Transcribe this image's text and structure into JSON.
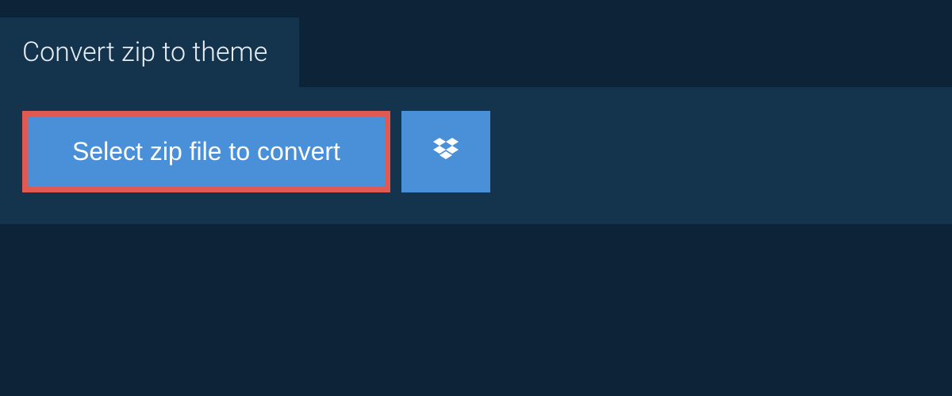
{
  "header": {
    "title": "Convert zip to theme"
  },
  "actions": {
    "select_label": "Select zip file to convert",
    "cloud_provider": "dropbox"
  },
  "colors": {
    "page_bg": "#0d2438",
    "panel_bg": "#14334d",
    "button_bg": "#4a90d9",
    "highlight_border": "#e05a52",
    "text_light": "#ffffff"
  }
}
